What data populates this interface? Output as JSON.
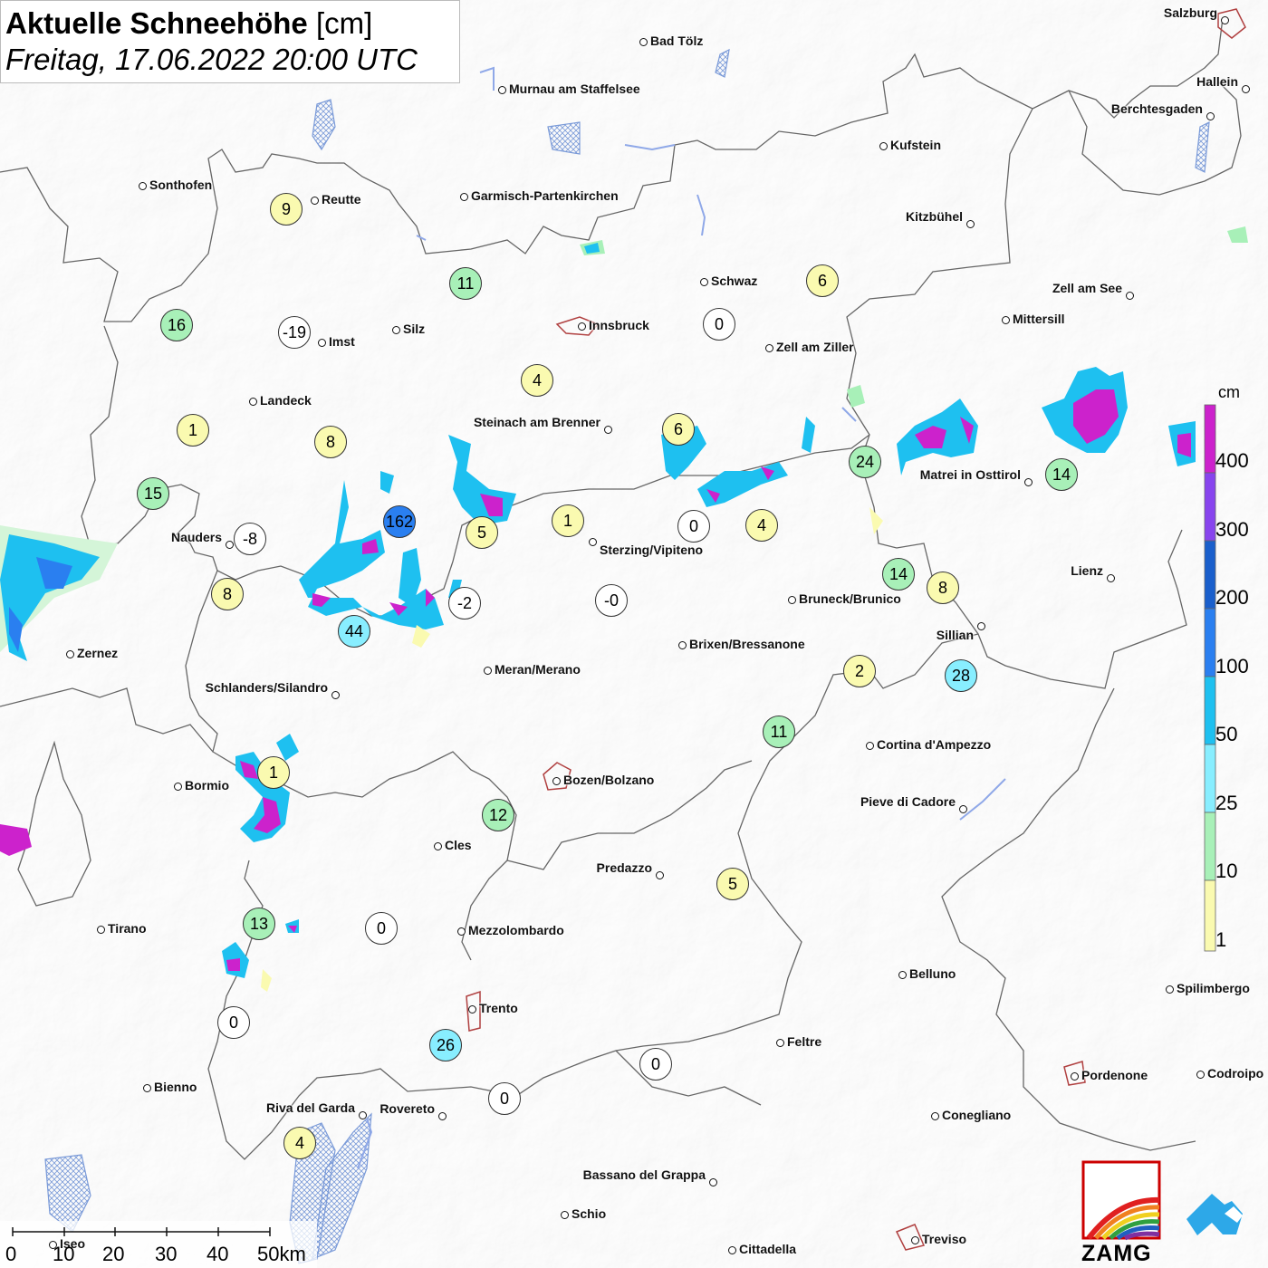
{
  "title": {
    "main": "Aktuelle Schneehöhe",
    "unit": "[cm]",
    "datetime": "Freitag, 17.06.2022 20:00 UTC"
  },
  "legend": {
    "unit": "cm",
    "labels": [
      "400",
      "300",
      "200",
      "100",
      "50",
      "25",
      "10",
      "1"
    ],
    "colors": [
      "#cc22cc",
      "#8844ee",
      "#1a5fcc",
      "#2a7ff0",
      "#1ec0f0",
      "#88eeff",
      "#a8f0b8",
      "#fafab0"
    ]
  },
  "cities": [
    {
      "name": "Bad Tölz"
    },
    {
      "name": "Salzburg"
    },
    {
      "name": "Murnau am Staffelsee"
    },
    {
      "name": "Hallein"
    },
    {
      "name": "Berchtesgaden"
    },
    {
      "name": "Kufstein"
    },
    {
      "name": "Sonthofen"
    },
    {
      "name": "Reutte"
    },
    {
      "name": "Garmisch-Partenkirchen"
    },
    {
      "name": "Kitzbühel"
    },
    {
      "name": "Schwaz"
    },
    {
      "name": "Zell am See"
    },
    {
      "name": "Innsbruck"
    },
    {
      "name": "Mittersill"
    },
    {
      "name": "Silz"
    },
    {
      "name": "Imst"
    },
    {
      "name": "Zell am Ziller"
    },
    {
      "name": "Landeck"
    },
    {
      "name": "Steinach am Brenner"
    },
    {
      "name": "Matrei in Osttirol"
    },
    {
      "name": "Nauders"
    },
    {
      "name": "Sterzing/Vipiteno"
    },
    {
      "name": "Lienz"
    },
    {
      "name": "Bruneck/Brunico"
    },
    {
      "name": "Sillian"
    },
    {
      "name": "Zernez"
    },
    {
      "name": "Brixen/Bressanone"
    },
    {
      "name": "Meran/Merano"
    },
    {
      "name": "Schlanders/Silandro"
    },
    {
      "name": "Cortina d'Ampezzo"
    },
    {
      "name": "Bozen/Bolzano"
    },
    {
      "name": "Bormio"
    },
    {
      "name": "Pieve di Cadore"
    },
    {
      "name": "Cles"
    },
    {
      "name": "Predazzo"
    },
    {
      "name": "Tirano"
    },
    {
      "name": "Mezzolombardo"
    },
    {
      "name": "Belluno"
    },
    {
      "name": "Spilimbergo"
    },
    {
      "name": "Trento"
    },
    {
      "name": "Feltre"
    },
    {
      "name": "Pordenone"
    },
    {
      "name": "Codroipo"
    },
    {
      "name": "Bienno"
    },
    {
      "name": "Riva del Garda"
    },
    {
      "name": "Rovereto"
    },
    {
      "name": "Conegliano"
    },
    {
      "name": "Bassano del Grappa"
    },
    {
      "name": "Schio"
    },
    {
      "name": "Treviso"
    },
    {
      "name": "Iseo"
    },
    {
      "name": "Cittadella"
    }
  ],
  "stations": [
    {
      "value": "9"
    },
    {
      "value": "11"
    },
    {
      "value": "6"
    },
    {
      "value": "16"
    },
    {
      "value": "-19"
    },
    {
      "value": "0"
    },
    {
      "value": "4"
    },
    {
      "value": "1"
    },
    {
      "value": "8"
    },
    {
      "value": "6"
    },
    {
      "value": "24"
    },
    {
      "value": "14"
    },
    {
      "value": "15"
    },
    {
      "value": "162"
    },
    {
      "value": "5"
    },
    {
      "value": "1"
    },
    {
      "value": "0"
    },
    {
      "value": "4"
    },
    {
      "value": "-8"
    },
    {
      "value": "14"
    },
    {
      "value": "8"
    },
    {
      "value": "8"
    },
    {
      "value": "-2"
    },
    {
      "value": "-0"
    },
    {
      "value": "44"
    },
    {
      "value": "2"
    },
    {
      "value": "28"
    },
    {
      "value": "11"
    },
    {
      "value": "1"
    },
    {
      "value": "12"
    },
    {
      "value": "5"
    },
    {
      "value": "13"
    },
    {
      "value": "0"
    },
    {
      "value": "0"
    },
    {
      "value": "26"
    },
    {
      "value": "0"
    },
    {
      "value": "0"
    },
    {
      "value": "4"
    }
  ],
  "scale_bar": {
    "labels": [
      "0",
      "10",
      "20",
      "30",
      "40",
      "50km"
    ]
  },
  "logos": {
    "zamg": "ZAMG",
    "zamg_icon": "rainbow-mountain-icon",
    "app_icon": "snow-cloud-app-icon"
  }
}
